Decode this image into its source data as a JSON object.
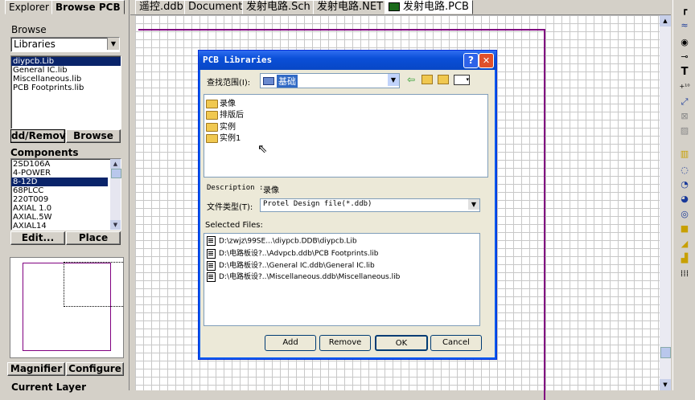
{
  "left_panel": {
    "tabs": [
      "Explorer",
      "Browse PCB"
    ],
    "browse_label": "Browse",
    "browse_select": "Libraries",
    "libraries": [
      "diypcb.Lib",
      "General IC.lib",
      "Miscellaneous.lib",
      "PCB Footprints.lib"
    ],
    "add_remove_label": "dd/Remove..",
    "browse_button": "Browse",
    "components_label": "Components",
    "components": [
      "2SD106A",
      "4-POWER",
      "8-12D",
      "68PLCC",
      "220T009",
      "AXIAL 1.0",
      "AXIAL.5W",
      "AXIAL14"
    ],
    "edit_button": "Edit...",
    "place_button": "Place",
    "magnifier_button": "Magnifier",
    "configure_button": "Configure",
    "current_layer_label": "Current Layer"
  },
  "doc_tabs": [
    "遥控.ddb",
    "Documents",
    "发射电路.Sch",
    "发射电路.NET",
    "发射电路.PCB"
  ],
  "dialog": {
    "title": "PCB Libraries",
    "help_glyph": "?",
    "close_glyph": "✕",
    "lookin_label": "查找范围(I):",
    "lookin_value": "基础",
    "folders": [
      "录像",
      "排版后",
      "实例",
      "实例1"
    ],
    "description_label": "Description :",
    "description_value": "录像",
    "filetype_label": "文件类型(T):",
    "filetype_value": "Protel Design file(*.ddb)",
    "selected_label": "Selected Files:",
    "selected_files": [
      "D:\\zwjz\\99SE...\\diypcb.DDB\\diypcb.Lib",
      "D:\\电路板设?..\\Advpcb.ddb\\PCB Footprints.lib",
      "D:\\电路板设?..\\General IC.ddb\\General IC.lib",
      "D:\\电路板设?..\\Miscellaneous.ddb\\Miscellaneous.lib"
    ],
    "add_button": "Add",
    "remove_button": "Remove",
    "ok_button": "OK",
    "cancel_button": "Cancel"
  },
  "toolbar_icons": [
    "route-icon",
    "bus-icon",
    "pad-icon",
    "via-icon",
    "text-icon",
    "coordinate-icon",
    "dimension-icon",
    "fill-pattern-icon",
    "arc-icon",
    "circle-icon",
    "fill-icon",
    "polygon-icon",
    "array-icon"
  ]
}
